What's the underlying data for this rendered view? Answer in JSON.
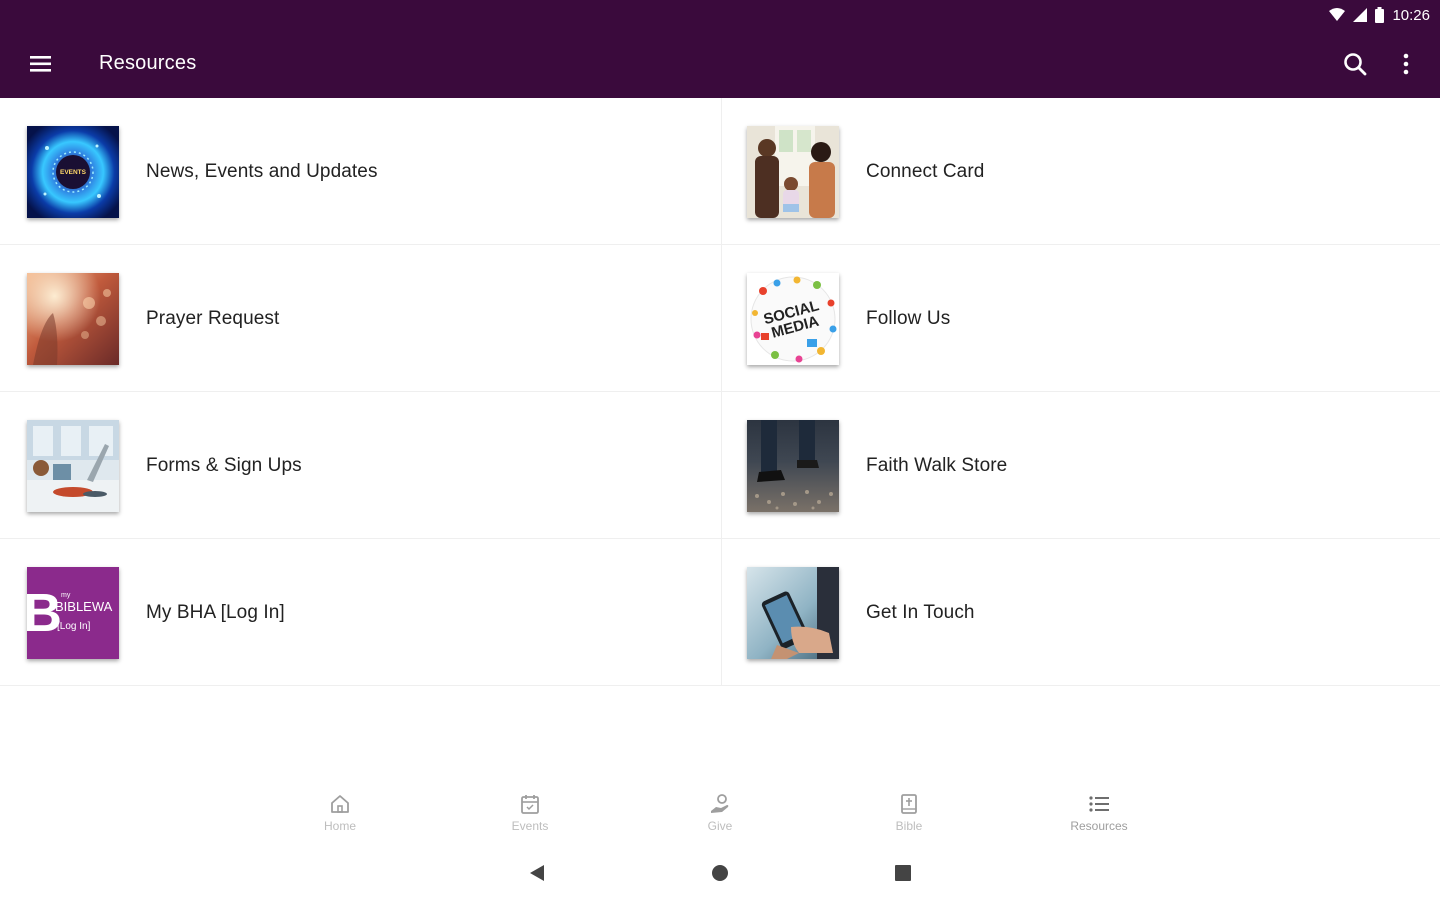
{
  "status_bar": {
    "time": "10:26"
  },
  "app_bar": {
    "title": "Resources"
  },
  "resources": [
    {
      "label": "News, Events and Updates",
      "thumb_icon": "news-events-image",
      "thumb_text": "EVENTS"
    },
    {
      "label": "Connect Card",
      "thumb_icon": "family-photo-image"
    },
    {
      "label": "Prayer Request",
      "thumb_icon": "bokeh-light-image"
    },
    {
      "label": "Follow Us",
      "thumb_icon": "social-media-image",
      "thumb_text": "SOCIAL MEDIA"
    },
    {
      "label": "Forms & Sign Ups",
      "thumb_icon": "desk-workspace-image"
    },
    {
      "label": "Faith Walk Store",
      "thumb_icon": "walking-feet-image"
    },
    {
      "label": "My BHA [Log In]",
      "thumb_icon": "biblewave-logo-image",
      "thumb_text_small": "my",
      "thumb_text_main": "BIBLEWA",
      "thumb_text_sub": "[Log In]"
    },
    {
      "label": "Get In Touch",
      "thumb_icon": "phone-hand-image"
    }
  ],
  "bottom_nav": [
    {
      "label": "Home",
      "icon": "home-icon"
    },
    {
      "label": "Events",
      "icon": "calendar-icon"
    },
    {
      "label": "Give",
      "icon": "give-icon"
    },
    {
      "label": "Bible",
      "icon": "bible-icon"
    },
    {
      "label": "Resources",
      "icon": "list-icon",
      "active": true
    }
  ],
  "colors": {
    "app_bar": "#3a0a3c",
    "label_text": "#222222",
    "nav_label": "#bdbdbd"
  }
}
